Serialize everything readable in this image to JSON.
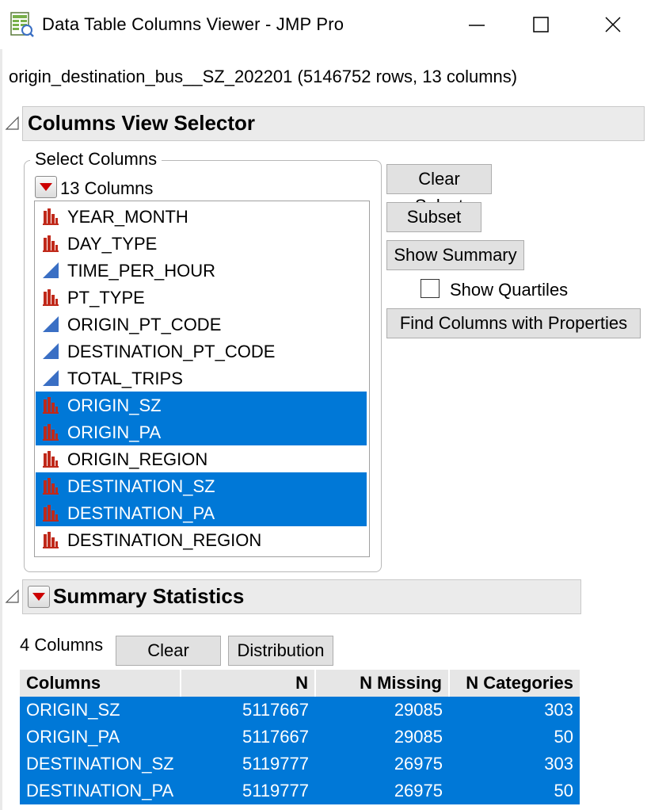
{
  "window": {
    "title": "Data Table Columns Viewer - JMP Pro",
    "minimize_icon": "minimize-icon",
    "maximize_icon": "maximize-icon",
    "close_icon": "close-icon"
  },
  "table_info": "origin_destination_bus__SZ_202201 (5146752 rows, 13 columns)",
  "columns_view_selector": {
    "title": "Columns View Selector",
    "group_label": "Select Columns",
    "column_count": "13 Columns",
    "columns": [
      {
        "name": "YEAR_MONTH",
        "type": "nominal",
        "selected": false
      },
      {
        "name": "DAY_TYPE",
        "type": "nominal",
        "selected": false
      },
      {
        "name": "TIME_PER_HOUR",
        "type": "continuous",
        "selected": false
      },
      {
        "name": "PT_TYPE",
        "type": "nominal",
        "selected": false
      },
      {
        "name": "ORIGIN_PT_CODE",
        "type": "continuous",
        "selected": false
      },
      {
        "name": "DESTINATION_PT_CODE",
        "type": "continuous",
        "selected": false
      },
      {
        "name": "TOTAL_TRIPS",
        "type": "continuous",
        "selected": false
      },
      {
        "name": "ORIGIN_SZ",
        "type": "nominal",
        "selected": true
      },
      {
        "name": "ORIGIN_PA",
        "type": "nominal",
        "selected": true
      },
      {
        "name": "ORIGIN_REGION",
        "type": "nominal",
        "selected": false
      },
      {
        "name": "DESTINATION_SZ",
        "type": "nominal",
        "selected": true
      },
      {
        "name": "DESTINATION_PA",
        "type": "nominal",
        "selected": true
      },
      {
        "name": "DESTINATION_REGION",
        "type": "nominal",
        "selected": false
      }
    ],
    "buttons": {
      "clear_select": "Clear Select",
      "subset": "Subset",
      "show_summary": "Show Summary",
      "show_quartiles": "Show Quartiles",
      "find_columns": "Find Columns with Properties"
    },
    "show_quartiles_checked": false
  },
  "summary_statistics": {
    "title": "Summary Statistics",
    "count": "4 Columns",
    "buttons": {
      "clear_select": "Clear Select",
      "distribution": "Distribution"
    },
    "headers": [
      "Columns",
      "N",
      "N Missing",
      "N Categories"
    ],
    "rows": [
      [
        "ORIGIN_SZ",
        "5117667",
        "29085",
        "303"
      ],
      [
        "ORIGIN_PA",
        "5117667",
        "29085",
        "50"
      ],
      [
        "DESTINATION_SZ",
        "5119777",
        "26975",
        "303"
      ],
      [
        "DESTINATION_PA",
        "5119777",
        "26975",
        "50"
      ]
    ]
  },
  "colors": {
    "selection": "#0078d7",
    "nominal_icon": "#c0291a",
    "continuous_icon": "#3a6fc4",
    "header_bg": "#ebebeb"
  }
}
